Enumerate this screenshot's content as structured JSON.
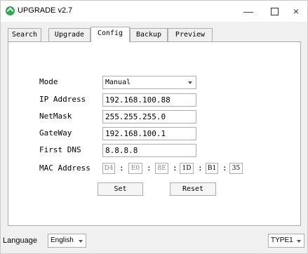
{
  "window": {
    "title": "UPGRADE v2.7"
  },
  "titlebar": {
    "minimize": "—",
    "close": "×"
  },
  "tabs": [
    {
      "label": "Search"
    },
    {
      "label": "Upgrade"
    },
    {
      "label": "Config"
    },
    {
      "label": "Backup"
    },
    {
      "label": "Preview"
    }
  ],
  "config": {
    "mode": {
      "label": "Mode",
      "value": "Manual"
    },
    "ip": {
      "label": "IP Address",
      "value": "192.168.100.88"
    },
    "netmask": {
      "label": "NetMask",
      "value": "255.255.255.0"
    },
    "gateway": {
      "label": "GateWay",
      "value": "192.168.100.1"
    },
    "dns": {
      "label": "First DNS",
      "value": "8.8.8.8"
    },
    "mac": {
      "label": "MAC Address",
      "separator": ":",
      "octets": [
        "D4",
        "E0",
        "8E",
        "1D",
        "B1",
        "35"
      ]
    },
    "set_label": "Set",
    "reset_label": "Reset"
  },
  "footer": {
    "language_label": "Language",
    "language_value": "English",
    "type_value": "TYPE1"
  }
}
